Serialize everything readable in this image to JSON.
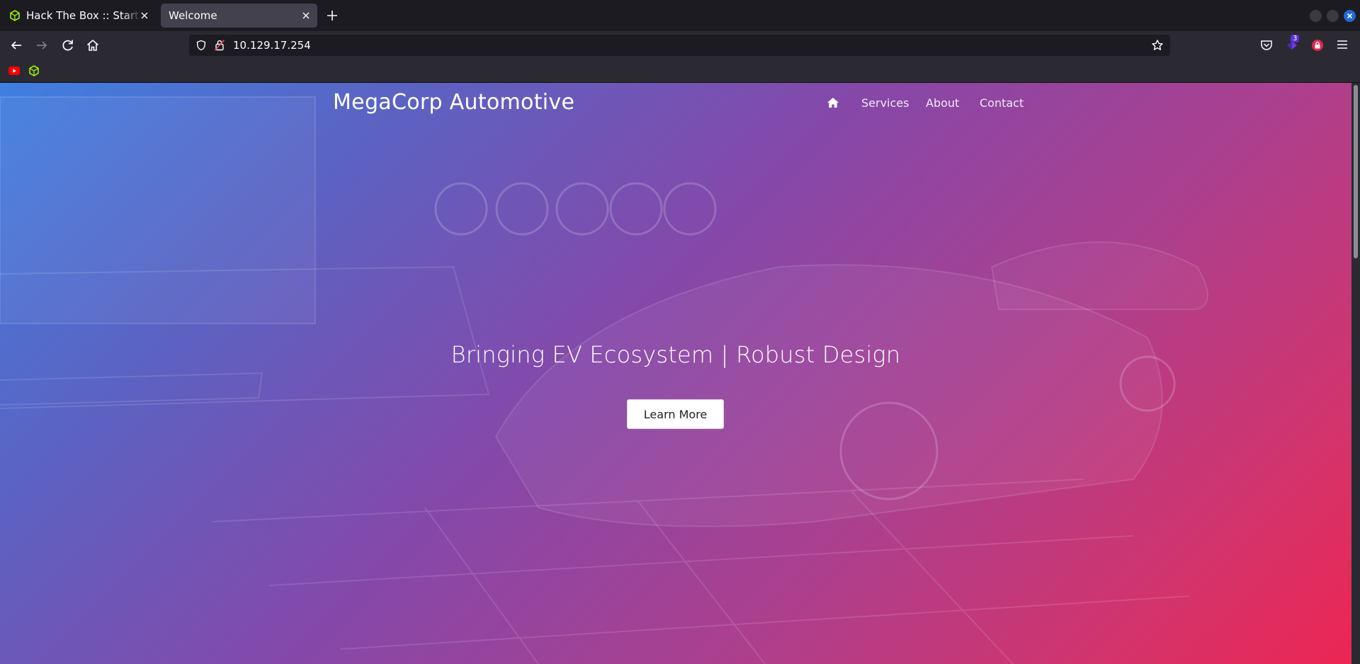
{
  "browser": {
    "tabs": [
      {
        "title": "Hack The Box :: Starting P",
        "icon": "htb-cube-icon",
        "active": false
      },
      {
        "title": "Welcome",
        "icon": "",
        "active": true
      }
    ],
    "url": "10.129.17.254",
    "extension_badge": "3",
    "colors": {
      "chrome_dark": "#1c1b22",
      "toolbar": "#2b2a33",
      "active_tab": "#42414d",
      "htb_green": "#9fef00"
    }
  },
  "site": {
    "title": "MegaCorp Automotive",
    "nav": {
      "home_icon": "home-icon",
      "services": "Services",
      "about": "About",
      "contact": "Contact"
    },
    "hero": {
      "heading": "Bringing EV Ecosystem | Robust Design",
      "button": "Learn More",
      "gradient": [
        "#3f7fe0",
        "#8548a9",
        "#ec2553"
      ]
    }
  }
}
